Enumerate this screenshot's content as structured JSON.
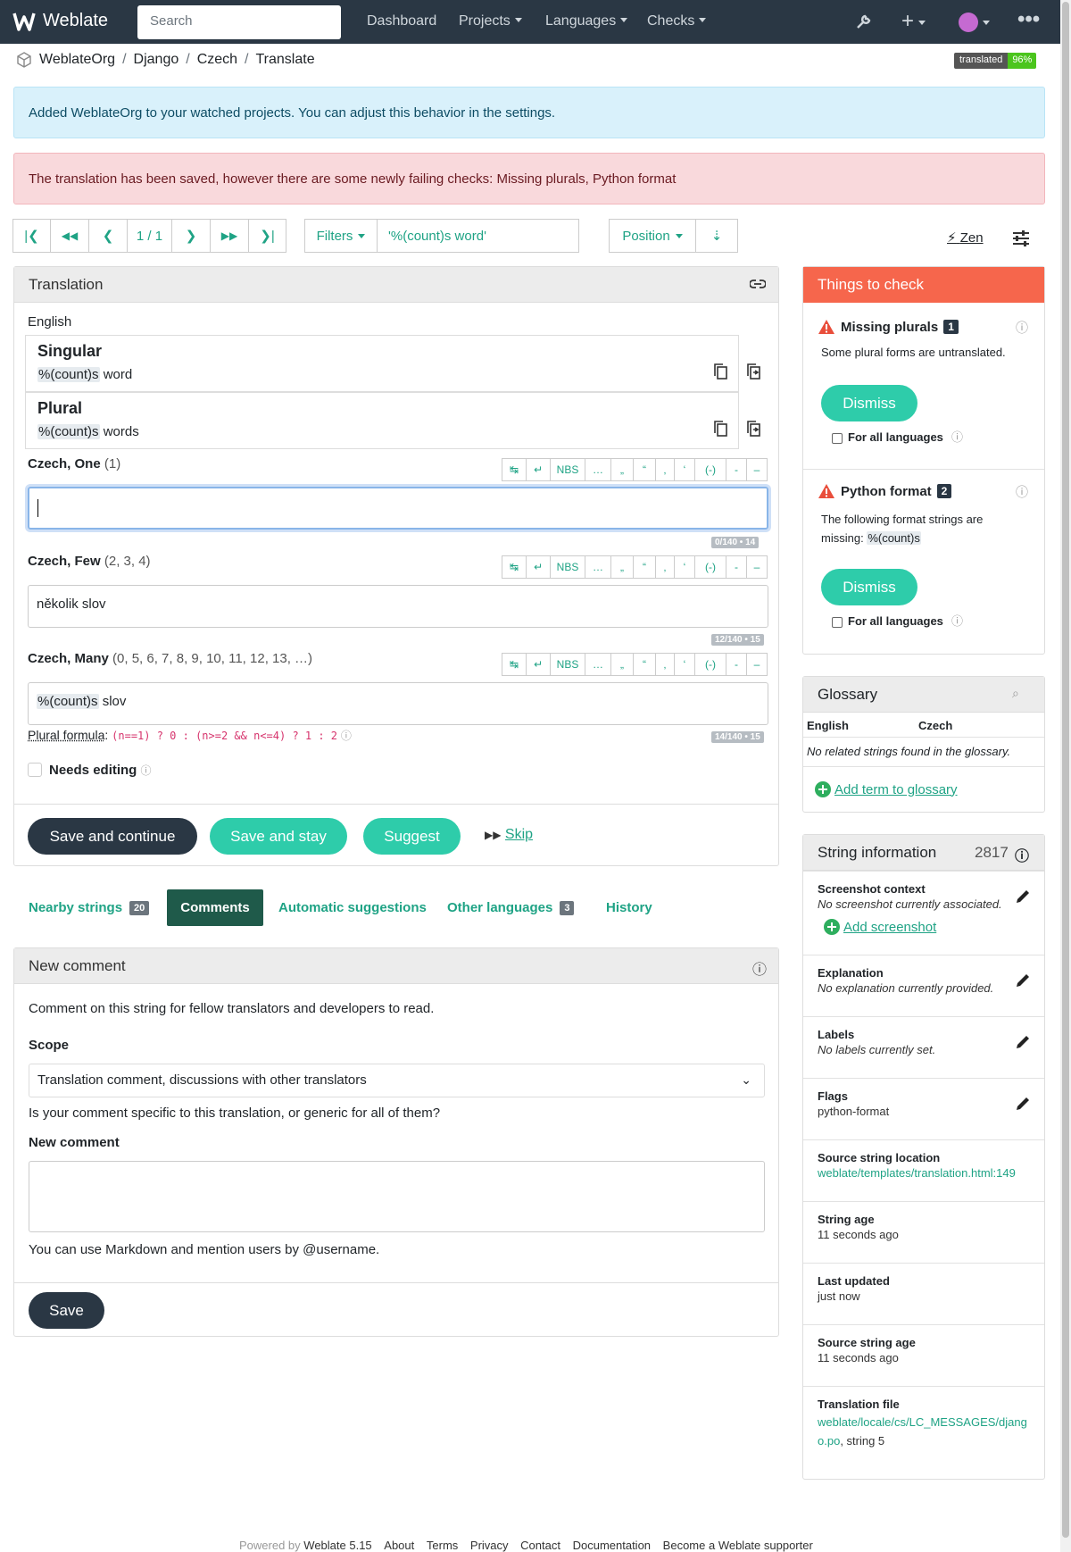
{
  "nav": {
    "brand": "Weblate",
    "search_placeholder": "Search",
    "links": [
      "Dashboard",
      "Projects",
      "Languages",
      "Checks"
    ]
  },
  "breadcrumb": [
    "WeblateOrg",
    "Django",
    "Czech",
    "Translate"
  ],
  "badge": {
    "label": "translated",
    "value": "96%"
  },
  "alerts": {
    "info": "Added WeblateOrg to your watched projects. You can adjust this behavior in the settings.",
    "danger": "The translation has been saved, however there are some newly failing checks: Missing plurals, Python format"
  },
  "toolbar": {
    "position_text": "1 / 1",
    "filters_label": "Filters",
    "query": "'%(count)s word'",
    "sort_label": "Position",
    "zen_label": "Zen"
  },
  "translation": {
    "title": "Translation",
    "source_lang": "English",
    "singular_label": "Singular",
    "singular_hl": "%(count)s",
    "singular_rest": " word",
    "plural_label": "Plural",
    "plural_hl": "%(count)s",
    "plural_rest": " words",
    "forms": [
      {
        "label": "Czech, One",
        "nums": "(1)",
        "value": "",
        "counter": "0/140 • 14"
      },
      {
        "label": "Czech, Few",
        "nums": "(2, 3, 4)",
        "value": "několik slov",
        "counter": "12/140 • 15"
      },
      {
        "label": "Czech, Many",
        "nums": "(0, 5, 6, 7, 8, 9, 10, 11, 12, 13, …)",
        "value_hl": "%(count)s",
        "value_rest": " slov",
        "counter": "14/140 • 15"
      }
    ],
    "specials": [
      "↹",
      "↵",
      "NBS",
      "…",
      "„",
      "“",
      "‚",
      "‘",
      "(-)",
      "-",
      "–"
    ],
    "plural_formula_label": "Plural formula",
    "plural_formula": "(n==1) ? 0 : (n>=2 && n<=4) ? 1 : 2",
    "needs_editing": "Needs editing",
    "buttons": {
      "save_continue": "Save and continue",
      "save_stay": "Save and stay",
      "suggest": "Suggest",
      "skip": "Skip"
    }
  },
  "tabs": [
    {
      "label": "Nearby strings",
      "count": "20"
    },
    {
      "label": "Comments"
    },
    {
      "label": "Automatic suggestions"
    },
    {
      "label": "Other languages",
      "count": "3"
    },
    {
      "label": "History"
    }
  ],
  "comment": {
    "title": "New comment",
    "intro": "Comment on this string for fellow translators and developers to read.",
    "scope_label": "Scope",
    "scope_value": "Translation comment, discussions with other translators",
    "scope_help": "Is your comment specific to this translation, or generic for all of them?",
    "new_comment_label": "New comment",
    "markdown_help": "You can use Markdown and mention users by @username.",
    "save": "Save"
  },
  "checks": {
    "title": "Things to check",
    "items": [
      {
        "name": "Missing plurals",
        "count": "1",
        "desc": "Some plural forms are untranslated.",
        "dismiss": "Dismiss",
        "all_langs": "For all languages"
      },
      {
        "name": "Python format",
        "count": "2",
        "desc": "The following format strings are missing:",
        "desc_hl": "%(count)s",
        "dismiss": "Dismiss",
        "all_langs": "For all languages"
      }
    ]
  },
  "glossary": {
    "title": "Glossary",
    "col_source": "English",
    "col_target": "Czech",
    "empty": "No related strings found in the glossary.",
    "add": "Add term to glossary"
  },
  "info": {
    "title": "String information",
    "id": "2817",
    "screenshot_label": "Screenshot context",
    "screenshot_value": "No screenshot currently associated.",
    "add_screenshot": "Add screenshot",
    "explanation_label": "Explanation",
    "explanation_value": "No explanation currently provided.",
    "labels_label": "Labels",
    "labels_value": "No labels currently set.",
    "flags_label": "Flags",
    "flags_value": "python-format",
    "location_label": "Source string location",
    "location_value": "weblate/templates/translation.html:149",
    "age_label": "String age",
    "age_value": "11 seconds ago",
    "updated_label": "Last updated",
    "updated_value": "just now",
    "src_age_label": "Source string age",
    "src_age_value": "11 seconds ago",
    "file_label": "Translation file",
    "file_link_1": "weblate/locale/cs/LC_MESSAGES/djang",
    "file_link_2": "o.po",
    "file_rest": ", string 5"
  },
  "footer": {
    "powered": "Powered by",
    "version": "Weblate 5.15",
    "links": [
      "About",
      "Terms",
      "Privacy",
      "Contact",
      "Documentation",
      "Become a Weblate supporter"
    ]
  },
  "colors": {
    "navbar": "#2a3744",
    "accent": "#1fa385",
    "pill": "#2eccaa",
    "dark_btn": "#2a3744",
    "checks_header": "#f6664c"
  }
}
